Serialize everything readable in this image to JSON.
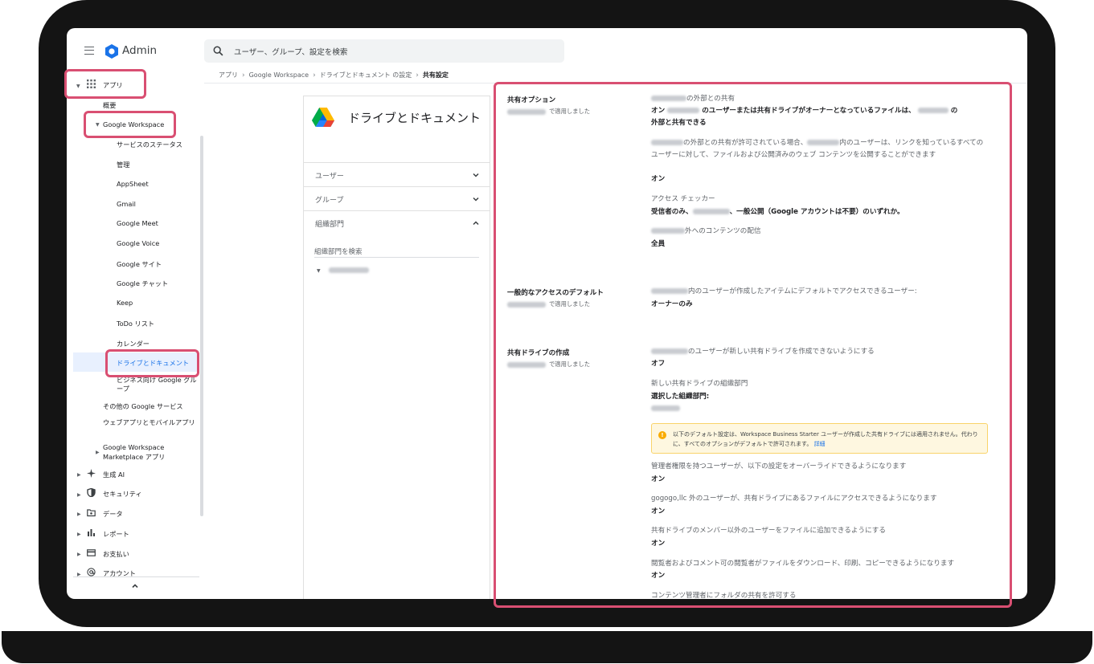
{
  "app": {
    "title": "Admin",
    "search_placeholder": "ユーザー、グループ、設定を検索"
  },
  "breadcrumb": [
    "アプリ",
    "Google Workspace",
    "ドライブとドキュメント の設定",
    "共有設定"
  ],
  "sidebar": {
    "apps": "アプリ",
    "overview": "概要",
    "workspace": "Google Workspace",
    "workspace_items": [
      "サービスのステータス",
      "管理",
      "AppSheet",
      "Gmail",
      "Google Meet",
      "Google Voice",
      "Google サイト",
      "Google チャット",
      "Keep",
      "ToDo リスト",
      "カレンダー",
      "ドライブとドキュメント"
    ],
    "business_groups": "ビジネス向け Google グループ",
    "other_services": "その他の Google サービス",
    "web_mobile": "ウェブアプリとモバイルアプリ",
    "marketplace": "Google Workspace Marketplace アプリ",
    "sections": [
      "生成 AI",
      "セキュリティ",
      "データ",
      "レポート",
      "お支払い",
      "アカウント"
    ]
  },
  "drive_panel": {
    "title": "ドライブとドキュメント",
    "rows": [
      "ユーザー",
      "グループ",
      "組織部門"
    ],
    "org_search_placeholder": "組織部門を検索"
  },
  "settings": {
    "sharing": {
      "label": "共有オプション",
      "applied": "で適用しました",
      "external_title": "の外部との共有",
      "external_value_a": "オン",
      "external_value_b": "のユーザーまたは共有ドライブがオーナーとなっているファイルは、",
      "external_value_c": "の",
      "external_value_d": "外部と共有できる",
      "publish_a": "の外部との共有が許可されている場合、",
      "publish_b": "内のユーザーは、リンクを知っているすべてのユーザーに対して、ファイルおよび公開済みのウェブ コンテンツを公開することができます",
      "publish_value": "オン",
      "checker_title": "アクセス チェッカー",
      "checker_value_a": "受信者のみ、",
      "checker_value_b": "、一般公開（Google アカウントは不要）のいずれか。",
      "distribution_title": "外へのコンテンツの配信",
      "distribution_value": "全員"
    },
    "general_access": {
      "label": "一般的なアクセスのデフォルト",
      "applied": "で適用しました",
      "title": "内のユーザーが作成したアイテムにデフォルトでアクセスできるユーザー:",
      "value": "オーナーのみ"
    },
    "shared_drive": {
      "label": "共有ドライブの作成",
      "applied": "で適用しました",
      "prevent_title": "のユーザーが新しい共有ドライブを作成できないようにする",
      "prevent_value": "オフ",
      "org_title": "新しい共有ドライブの組織部門",
      "org_value": "選択した組織部門:",
      "notice": "以下のデフォルト設定は、Workspace Business Starter ユーザーが作成した共有ドライブには適用されません。代わりに、すべてのオプションがデフォルトで許可されます。",
      "notice_link": "詳細",
      "override_title": "管理者権限を持つユーザーが、以下の設定をオーバーライドできるようになります",
      "override_value": "オン",
      "external_access_title": "gogogo,llc 外のユーザーが、共有ドライブにあるファイルにアクセスできるようになります",
      "external_access_value": "オン",
      "add_nonmember_title": "共有ドライブのメンバー以外のユーザーをファイルに追加できるようにする",
      "add_nonmember_value": "オン",
      "download_title": "閲覧者およびコメント可の閲覧者がファイルをダウンロード、印刷、コピーできるようになります",
      "download_value": "オン",
      "folder_title": "コンテンツ管理者にフォルダの共有を許可する"
    }
  },
  "colors": {
    "highlight": "#d94f72",
    "active_nav_bg": "#e8f0fe",
    "active_nav_text": "#1a73e8",
    "notice_bg": "#fef7e0",
    "notice_icon": "#f9ab00"
  }
}
